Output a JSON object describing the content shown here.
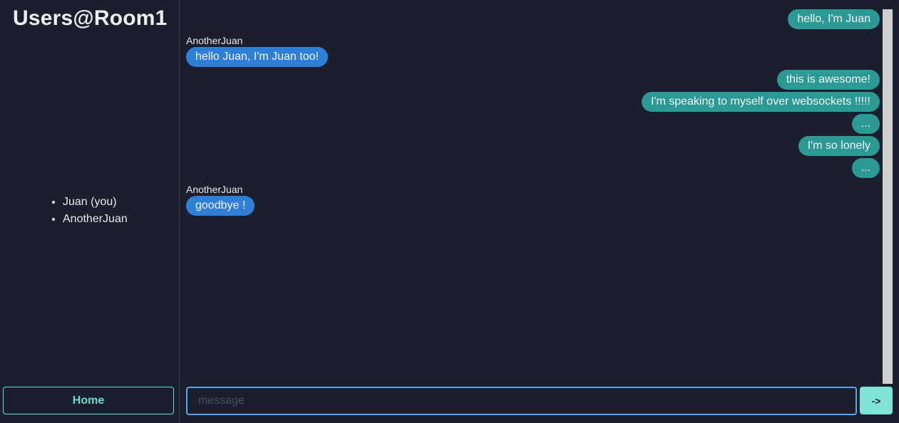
{
  "sidebar": {
    "title": "Users@Room1",
    "users": [
      "Juan (you)",
      "AnotherJuan"
    ],
    "home_label": "Home"
  },
  "chat": {
    "messages": [
      {
        "mine": true,
        "sender": "",
        "text": "hello, I'm Juan"
      },
      {
        "mine": false,
        "sender": "AnotherJuan",
        "text": "hello Juan, I'm Juan too!"
      },
      {
        "mine": true,
        "sender": "",
        "text": "this is awesome!"
      },
      {
        "mine": true,
        "sender": "",
        "text": "I'm speaking to myself over websockets !!!!!"
      },
      {
        "mine": true,
        "sender": "",
        "text": "..."
      },
      {
        "mine": true,
        "sender": "",
        "text": "I'm so lonely"
      },
      {
        "mine": true,
        "sender": "",
        "text": "..."
      },
      {
        "mine": false,
        "sender": "AnotherJuan",
        "text": "goodbye !"
      }
    ]
  },
  "composer": {
    "placeholder": "message",
    "value": "",
    "send_label": "->"
  },
  "colors": {
    "background": "#1b1f2d",
    "my_bubble": "#2b9a95",
    "their_bubble": "#2f7fd6",
    "accent": "#6fd9cf"
  }
}
